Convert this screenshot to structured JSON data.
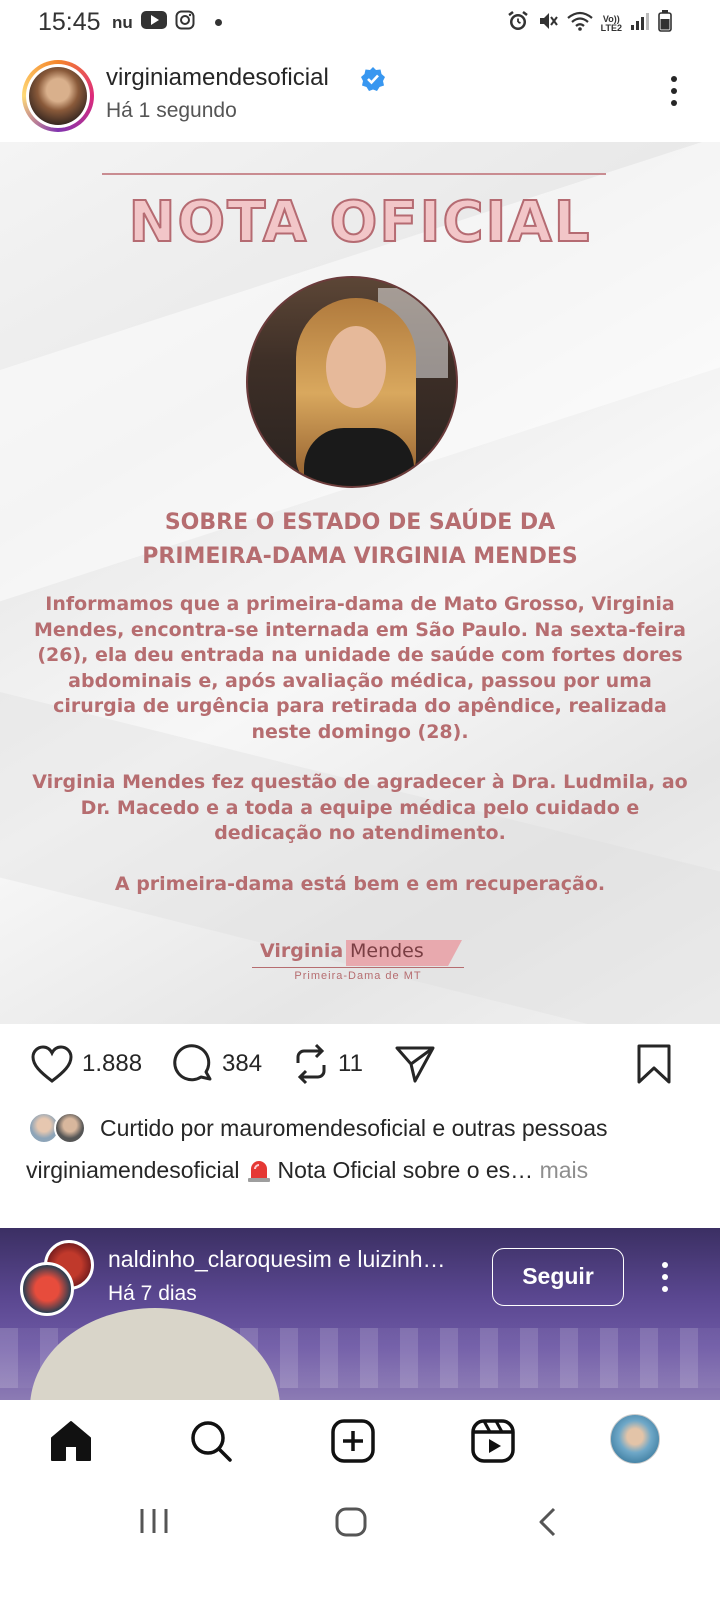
{
  "status_bar": {
    "time": "15:45",
    "left_icons": [
      "nubank-icon",
      "youtube-icon",
      "instagram-icon",
      "dot-icon"
    ],
    "right_icons": [
      "alarm-icon",
      "mute-icon",
      "wifi-icon",
      "volte-icon",
      "signal-icon",
      "battery-icon"
    ],
    "network_label_top": "Vo))",
    "network_label_bottom": "LTE2"
  },
  "post": {
    "username": "virginiamendesoficial",
    "verified": true,
    "time": "Há 1 segundo",
    "image": {
      "title": "NOTA OFICIAL",
      "headline_line1": "SOBRE O ESTADO DE SAÚDE DA",
      "headline_line2": "PRIMEIRA-DAMA VIRGINIA MENDES",
      "paragraph1": "Informamos que a primeira-dama de Mato Grosso, Virginia Mendes, encontra-se internada em São Paulo. Na sexta-feira (26), ela deu entrada na unidade de saúde com fortes dores abdominais e, após avaliação médica, passou por uma cirurgia de urgência para retirada do apêndice, realizada neste domingo (28).",
      "paragraph2": "Virginia Mendes fez questão de agradecer à Dra. Ludmila, ao Dr. Macedo e a toda a equipe médica pelo cuidado e dedicação no atendimento.",
      "paragraph3": "A primeira-dama está bem e em recuperação.",
      "signature_first": "Virginia",
      "signature_last": "Mendes",
      "signature_sub": "Primeira-Dama de MT"
    },
    "likes": "1.888",
    "comments": "384",
    "reposts": "11",
    "liked_by_prefix": "Curtido por",
    "liked_by_user": "mauromendesoficial",
    "liked_by_and": "e",
    "liked_by_others": "outras pessoas",
    "caption_user": "virginiamendesoficial",
    "caption_text": "Nota Oficial sobre o es…",
    "caption_more": "mais"
  },
  "next_post": {
    "users": "naldinho_claroquesim e luizinh…",
    "time": "Há 7 dias",
    "follow_label": "Seguir"
  },
  "bottom_nav": [
    "home-icon",
    "search-icon",
    "create-icon",
    "reels-icon",
    "profile-avatar"
  ],
  "system_nav": [
    "recents-icon",
    "home-button-icon",
    "back-icon"
  ],
  "colors": {
    "accent_pink": "#b66d70",
    "verified_blue": "#3897f0",
    "text_primary": "#262626",
    "text_secondary": "#8e8e8e"
  }
}
